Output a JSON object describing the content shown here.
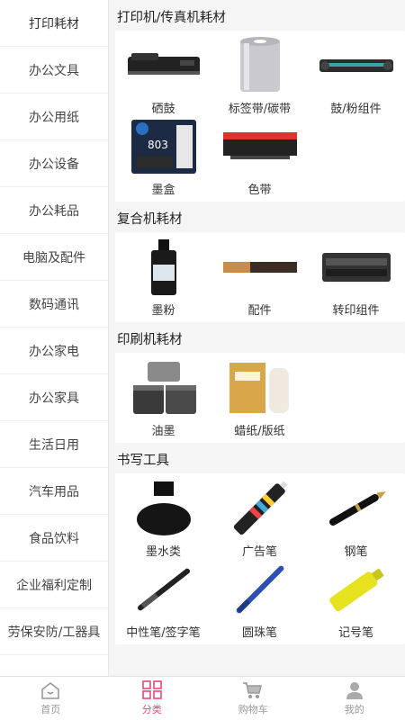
{
  "sidebar": {
    "items": [
      {
        "label": "打印耗材"
      },
      {
        "label": "办公文具"
      },
      {
        "label": "办公用纸"
      },
      {
        "label": "办公设备"
      },
      {
        "label": "办公耗品"
      },
      {
        "label": "电脑及配件"
      },
      {
        "label": "数码通讯"
      },
      {
        "label": "办公家电"
      },
      {
        "label": "办公家具"
      },
      {
        "label": "生活日用"
      },
      {
        "label": "汽车用品"
      },
      {
        "label": "食品饮料"
      },
      {
        "label": "企业福利定制"
      },
      {
        "label": "劳保安防/工器具"
      }
    ]
  },
  "sections": [
    {
      "title": "打印机/传真机耗材",
      "products": [
        {
          "label": "硒鼓",
          "icon": "toner-cartridge-image"
        },
        {
          "label": "标签带/碳带",
          "icon": "ribbon-roll-image"
        },
        {
          "label": "鼓/粉组件",
          "icon": "drum-unit-image"
        },
        {
          "label": "墨盒",
          "icon": "ink-cartridge-image"
        },
        {
          "label": "色带",
          "icon": "ribbon-cartridge-image"
        }
      ]
    },
    {
      "title": "复合机耗材",
      "products": [
        {
          "label": "墨粉",
          "icon": "toner-bottle-image"
        },
        {
          "label": "配件",
          "icon": "accessory-part-image"
        },
        {
          "label": "转印组件",
          "icon": "transfer-unit-image"
        }
      ]
    },
    {
      "title": "印刷机耗材",
      "products": [
        {
          "label": "油墨",
          "icon": "ink-cans-image"
        },
        {
          "label": "蜡纸/版纸",
          "icon": "master-paper-image"
        }
      ]
    },
    {
      "title": "书写工具",
      "products": [
        {
          "label": "墨水类",
          "icon": "ink-bottle-image"
        },
        {
          "label": "广告笔",
          "icon": "marker-pen-image"
        },
        {
          "label": "钢笔",
          "icon": "fountain-pen-image"
        },
        {
          "label": "中性笔/签字笔",
          "icon": "gel-pen-image"
        },
        {
          "label": "圆珠笔",
          "icon": "ballpoint-pen-image"
        },
        {
          "label": "记号笔",
          "icon": "highlighter-image"
        }
      ]
    }
  ],
  "tabbar": {
    "tabs": [
      {
        "label": "首页",
        "icon": "home-icon"
      },
      {
        "label": "分类",
        "icon": "category-grid-icon"
      },
      {
        "label": "购物车",
        "icon": "cart-icon"
      },
      {
        "label": "我的",
        "icon": "user-icon"
      }
    ],
    "active_color": "#e8477d",
    "inactive_color": "#999999"
  }
}
